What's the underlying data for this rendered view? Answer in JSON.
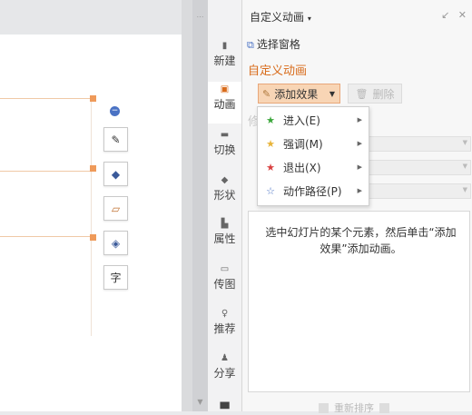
{
  "canvas": {
    "float_tools": [
      {
        "icon": "edit-shape-icon",
        "glyph": "✎"
      },
      {
        "icon": "fill-color-icon",
        "glyph": "◆"
      },
      {
        "icon": "line-color-icon",
        "glyph": "▱"
      },
      {
        "icon": "layers-icon",
        "glyph": "◈"
      },
      {
        "icon": "text-format-icon",
        "glyph": "字"
      }
    ],
    "colors": {
      "handle": "#ef9a5a",
      "guide": "#f0c9a6"
    }
  },
  "sidebar": {
    "items": [
      {
        "label": "新建",
        "icon": "new-slide-icon",
        "glyph": "▮"
      },
      {
        "label": "动画",
        "icon": "animation-icon",
        "glyph": "▣"
      },
      {
        "label": "切换",
        "icon": "transition-icon",
        "glyph": "▬"
      },
      {
        "label": "形状",
        "icon": "shape-icon",
        "glyph": "◆"
      },
      {
        "label": "属性",
        "icon": "properties-icon",
        "glyph": "▙"
      },
      {
        "label": "传图",
        "icon": "upload-image-icon",
        "glyph": "▭"
      },
      {
        "label": "推荐",
        "icon": "recommend-icon",
        "glyph": "♀"
      },
      {
        "label": "分享",
        "icon": "share-icon",
        "glyph": "♟"
      }
    ],
    "active": "动画"
  },
  "panel": {
    "title": "自定义动画",
    "title_caret": "▾",
    "select_pane": "选择窗格",
    "section_title": "自定义动画",
    "add_effect": "添加效果",
    "delete": "删除",
    "faded_label": "修",
    "info": "选中幻灯片的某个元素，然后单击“添加效果”添加动画。",
    "reorder": "重新排序",
    "accent_color": "#d86b1a"
  },
  "menu": {
    "items": [
      {
        "label": "进入(E)",
        "icon": "enter-star-icon",
        "color": "#3aa63a"
      },
      {
        "label": "强调(M)",
        "icon": "emphasis-star-icon",
        "color": "#e8b43a"
      },
      {
        "label": "退出(X)",
        "icon": "exit-star-icon",
        "color": "#d94040"
      },
      {
        "label": "动作路径(P)",
        "icon": "motion-path-star-icon",
        "color": "#4a72c4"
      }
    ]
  }
}
